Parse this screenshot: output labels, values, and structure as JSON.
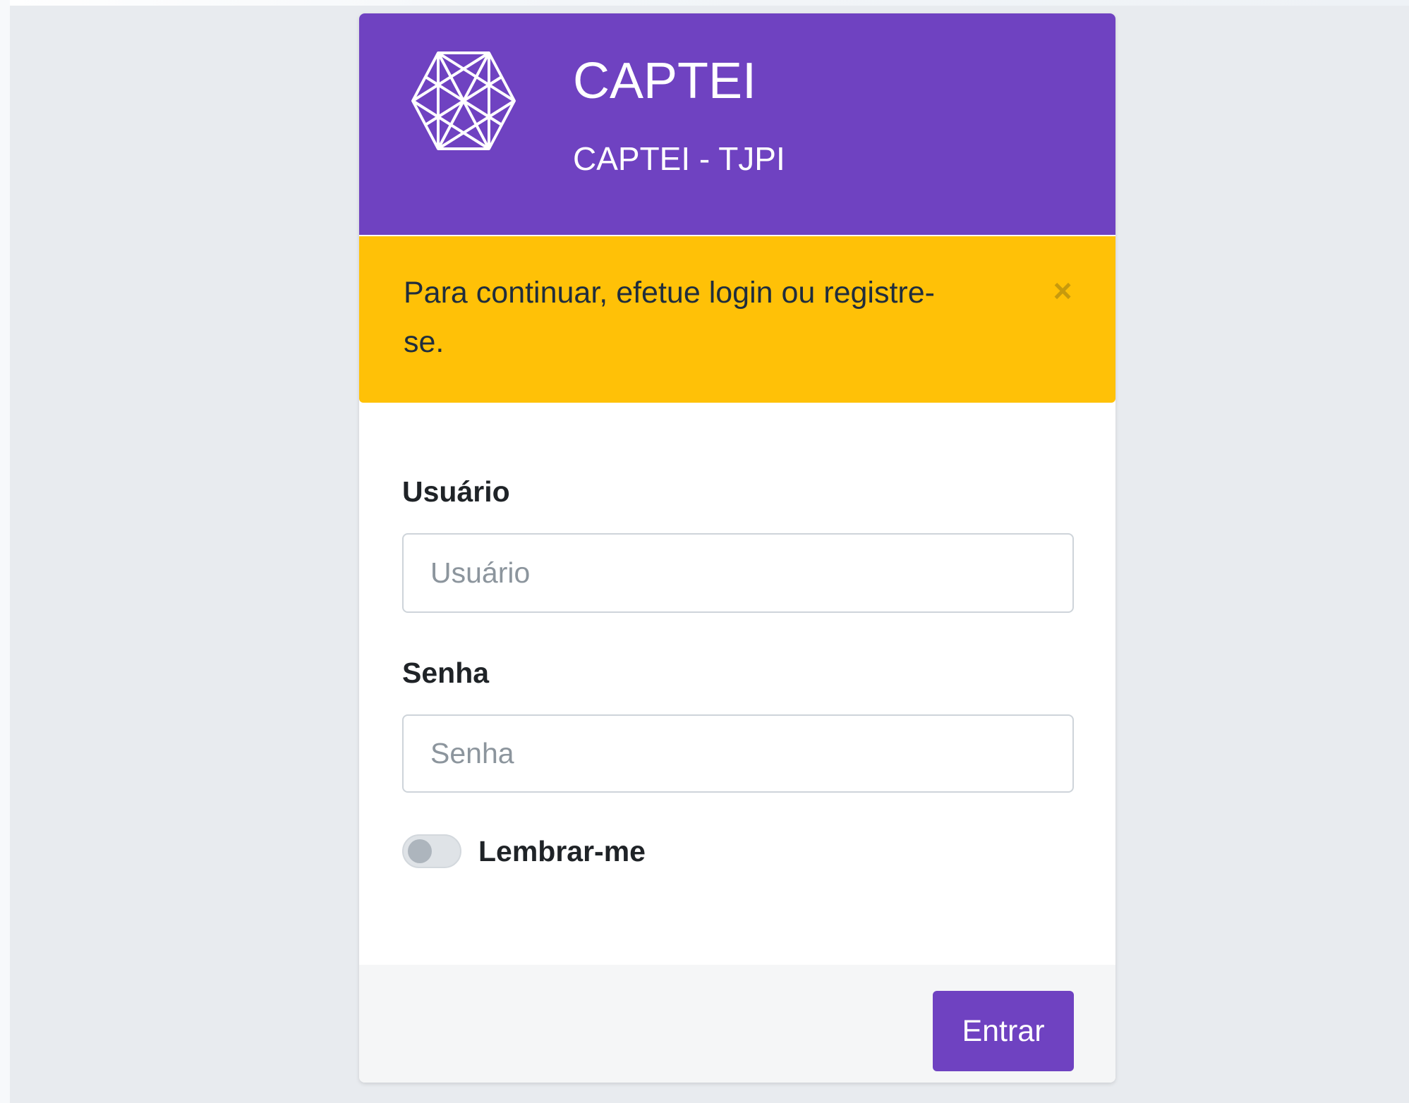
{
  "header": {
    "title": "CAPTEI",
    "subtitle": "CAPTEI - TJPI",
    "logo_icon": "hexagon-network-logo",
    "background_color": "#6f42c1"
  },
  "alert": {
    "message": "Para continuar, efetue login ou registre-se.",
    "close_label": "×",
    "background_color": "#ffc107"
  },
  "form": {
    "username": {
      "label": "Usuário",
      "placeholder": "Usuário",
      "value": ""
    },
    "password": {
      "label": "Senha",
      "placeholder": "Senha",
      "value": ""
    },
    "remember": {
      "label": "Lembrar-me",
      "checked": false
    }
  },
  "footer": {
    "submit_label": "Entrar",
    "accent_color": "#6f42c1"
  }
}
